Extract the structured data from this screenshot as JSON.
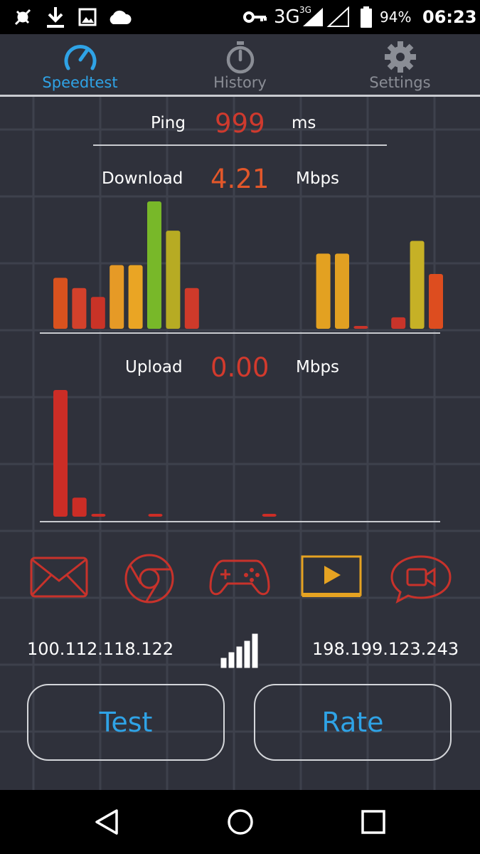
{
  "status_bar": {
    "network": "3G",
    "network_sup": "3G",
    "battery": "94%",
    "time": "06:23",
    "icons": [
      "usb-debug-icon",
      "download-icon",
      "image-icon",
      "cloud-icon",
      "key-icon",
      "signal-icon",
      "battery-icon"
    ]
  },
  "tabs": [
    {
      "label": "Speedtest",
      "icon": "speedometer-icon",
      "active": true
    },
    {
      "label": "History",
      "icon": "stopwatch-icon",
      "active": false
    },
    {
      "label": "Settings",
      "icon": "gear-icon",
      "active": false
    }
  ],
  "ping": {
    "label": "Ping",
    "value": "999",
    "unit": "ms"
  },
  "download": {
    "label": "Download",
    "value": "4.21",
    "unit": "Mbps"
  },
  "upload": {
    "label": "Upload",
    "value": "0.00",
    "unit": "Mbps"
  },
  "chart_data": [
    {
      "type": "bar",
      "name": "download-history",
      "levels": [
        0.4,
        0.32,
        0.25,
        0.5,
        0.5,
        1.0,
        0.77,
        0.32,
        0,
        0,
        0,
        0,
        0,
        0,
        0.59,
        0.59,
        0.01,
        0,
        0.09,
        0.69,
        0.43
      ],
      "colors": [
        "#d9521e",
        "#d3412b",
        "#c93327",
        "#e69a26",
        "#eaa524",
        "#78b829",
        "#b7ab23",
        "#cf3a2a",
        "#000",
        "#000",
        "#000",
        "#000",
        "#000",
        "#000",
        "#e3a121",
        "#e1a022",
        "#c8342a",
        "#000",
        "#c8342a",
        "#c6b126",
        "#dd4d1f"
      ]
    },
    {
      "type": "bar",
      "name": "upload-history",
      "levels": [
        1.0,
        0.15,
        0.01,
        0,
        0,
        0.01,
        0,
        0,
        0,
        0,
        0,
        0.01
      ],
      "colors": [
        "#cc2d26",
        "#cc2d26",
        "#cc2d26",
        "#cc2d26",
        "#cc2d26",
        "#cc2d26",
        "#cc2d26",
        "#cc2d26",
        "#cc2d26",
        "#cc2d26",
        "#cc2d26",
        "#cc2d26"
      ]
    }
  ],
  "apps": [
    {
      "icon": "email-icon",
      "color": "#c8322b"
    },
    {
      "icon": "chrome-icon",
      "color": "#c8322b"
    },
    {
      "icon": "gamepad-icon",
      "color": "#c8322b"
    },
    {
      "icon": "video-icon",
      "color": "#e6a322"
    },
    {
      "icon": "video-chat-icon",
      "color": "#c8322b"
    }
  ],
  "client_ip": "100.112.118.122",
  "server_ip": "198.199.123.243",
  "buttons": {
    "test": "Test",
    "rate": "Rate"
  },
  "colors": {
    "accent": "#2fa3e6",
    "ping": "#cf3a2e",
    "download": "#e2572a",
    "upload": "#d23a2d"
  }
}
